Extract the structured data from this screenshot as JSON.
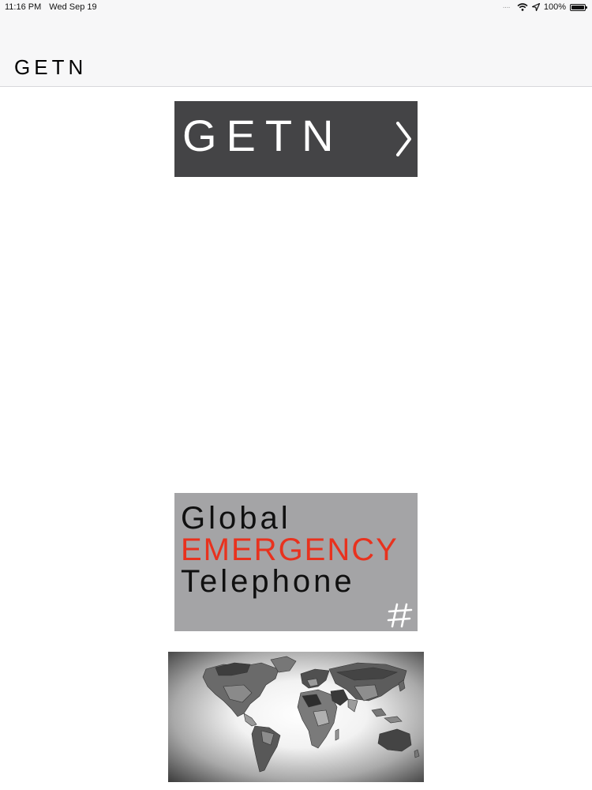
{
  "status_bar": {
    "time": "11:16 PM",
    "date": "Wed Sep 19",
    "battery": "100%",
    "battery_level": 1.0,
    "icons": [
      "signal-dots-icon",
      "wifi-icon",
      "location-arrow-icon",
      "battery-icon"
    ]
  },
  "nav": {
    "title": "GETN"
  },
  "banner": {
    "label": "GETN",
    "icon": "chevron-right-icon",
    "background": "#444446"
  },
  "logo": {
    "line1": "Global",
    "line2": "EMERGENCY",
    "line3": "Telephone",
    "accent_color": "#e8321e",
    "icon": "hash-icon"
  },
  "map": {
    "icon": "world-map-image"
  }
}
